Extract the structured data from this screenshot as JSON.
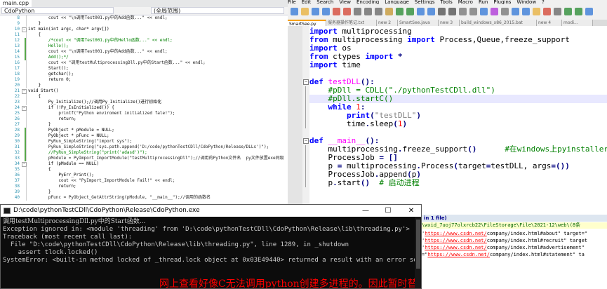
{
  "vs": {
    "tab_label": "main.cpp",
    "nav_left": "CdoPython",
    "nav_right": "(全局范围)",
    "lines": [
      {
        "n": "8",
        "t": "        cout << \"\\n调用Test001.py中的Add函数...\" << endl;"
      },
      {
        "n": "9",
        "t": "    }"
      },
      {
        "n": "10",
        "t": "int main(int argc, char* argv[])"
      },
      {
        "n": "11",
        "t": "    {"
      },
      {
        "n": "12",
        "t": "        /*cout << \"调用Test001.py中的Hello函数...\" << endl;"
      },
      {
        "n": "13",
        "t": "        Hello();"
      },
      {
        "n": "14",
        "t": "        cout << \"\\n调用Test001.py中的Add函数...\" << endl;"
      },
      {
        "n": "15",
        "t": "        Add();*/"
      },
      {
        "n": "16",
        "t": "        cout << \"调用testMultiprocessingDll.py中的Start函数...\" << endl;"
      },
      {
        "n": "17",
        "t": "        Start();"
      },
      {
        "n": "18",
        "t": "        getchar();"
      },
      {
        "n": "19",
        "t": "        return 0;"
      },
      {
        "n": "20",
        "t": "    }"
      },
      {
        "n": "21",
        "t": "void Start()"
      },
      {
        "n": "22",
        "t": "    {"
      },
      {
        "n": "23",
        "t": "        Py_Initialize();//调用Py_Initialize()进行初始化"
      },
      {
        "n": "24",
        "t": "        if (!Py_IsInitialized()) {"
      },
      {
        "n": "25",
        "t": "            printf(\"Python enviroment initialized fale!\");"
      },
      {
        "n": "26",
        "t": "            return;"
      },
      {
        "n": "27",
        "t": "        }"
      },
      {
        "n": "28",
        "t": "        PyObject * pModule = NULL;"
      },
      {
        "n": "29",
        "t": "        PyObject * pFunc = NULL;"
      },
      {
        "n": "30",
        "t": "        PyRun_SimpleString(\"import sys\");"
      },
      {
        "n": "31",
        "t": "        PyRun_SimpleString(\"sys.path.append('D:/code/pythonTestCDll/CdoPython/Release/DLLs')\");"
      },
      {
        "n": "32",
        "t": "        //PyRun_SimpleString(\"print('adasd')\");"
      },
      {
        "n": "33",
        "t": "        pModule = PyImport_ImportModule(\"testMultiprocessingDll\");//调用的Python文件名  py文件放置exe同级"
      },
      {
        "n": "34",
        "t": "        if (pModule == NULL)"
      },
      {
        "n": "35",
        "t": "        {"
      },
      {
        "n": "36",
        "t": "            PyErr_Print();"
      },
      {
        "n": "37",
        "t": "            cout << \"PyImport_ImportModule Fail!\" << endl;"
      },
      {
        "n": "38",
        "t": "            return;"
      },
      {
        "n": "39",
        "t": "        }"
      },
      {
        "n": "40",
        "t": "        pFunc = PyObject_GetAttrString(pModule, \"__main__\");//调用的函数名"
      }
    ]
  },
  "npp": {
    "menu": [
      "File",
      "Edit",
      "Search",
      "View",
      "Encoding",
      "Language",
      "Settings",
      "Tools",
      "Macro",
      "Run",
      "Plugins",
      "Window",
      "?"
    ],
    "tabs": [
      "SmartSee.py",
      "服务器操作笔记.txt",
      "new 2",
      "SmartSee.java",
      "new 3",
      "build_windows_x86_2015.bat",
      "new 4",
      "modi..."
    ],
    "active_tab": 0,
    "code": [
      {
        "parts": [
          {
            "c": "kw",
            "t": "import"
          },
          {
            "c": "",
            "t": " multiprocessing"
          }
        ]
      },
      {
        "parts": [
          {
            "c": "kw",
            "t": "from"
          },
          {
            "c": "",
            "t": " multiprocessing "
          },
          {
            "c": "kw",
            "t": "import"
          },
          {
            "c": "",
            "t": " Process,Queue,freeze_support"
          }
        ]
      },
      {
        "parts": [
          {
            "c": "kw",
            "t": "import"
          },
          {
            "c": "",
            "t": " os"
          }
        ]
      },
      {
        "parts": [
          {
            "c": "kw",
            "t": "from"
          },
          {
            "c": "",
            "t": " ctypes "
          },
          {
            "c": "kw",
            "t": "import"
          },
          {
            "c": "",
            "t": " "
          },
          {
            "c": "op",
            "t": "*"
          }
        ]
      },
      {
        "parts": [
          {
            "c": "kw",
            "t": "import"
          },
          {
            "c": "",
            "t": " time"
          }
        ]
      },
      {
        "parts": []
      },
      {
        "parts": [
          {
            "c": "kw",
            "t": "def"
          },
          {
            "c": "",
            "t": " "
          },
          {
            "c": "fn",
            "t": "testDLL"
          },
          {
            "c": "op",
            "t": "():"
          }
        ]
      },
      {
        "parts": [
          {
            "c": "",
            "t": "    "
          },
          {
            "c": "cm",
            "t": "#pDll = CDLL(\"./pythonTestCDll.dll\")"
          }
        ]
      },
      {
        "parts": [
          {
            "c": "",
            "t": "    "
          },
          {
            "c": "cm",
            "t": "#pDll.startC()"
          }
        ],
        "hl": true
      },
      {
        "parts": [
          {
            "c": "",
            "t": "    "
          },
          {
            "c": "kw",
            "t": "while"
          },
          {
            "c": "",
            "t": " "
          },
          {
            "c": "nm",
            "t": "1"
          },
          {
            "c": "op",
            "t": ":"
          }
        ]
      },
      {
        "parts": [
          {
            "c": "",
            "t": "        "
          },
          {
            "c": "kw",
            "t": "print"
          },
          {
            "c": "op",
            "t": "("
          },
          {
            "c": "st",
            "t": "\"testDLL\""
          },
          {
            "c": "op",
            "t": ")"
          }
        ]
      },
      {
        "parts": [
          {
            "c": "",
            "t": "        time"
          },
          {
            "c": "op",
            "t": "."
          },
          {
            "c": "",
            "t": "sleep"
          },
          {
            "c": "op",
            "t": "("
          },
          {
            "c": "nm",
            "t": "1"
          },
          {
            "c": "op",
            "t": ")"
          }
        ]
      },
      {
        "parts": []
      },
      {
        "parts": [
          {
            "c": "kw",
            "t": "def"
          },
          {
            "c": "",
            "t": " "
          },
          {
            "c": "fn",
            "t": "__main__"
          },
          {
            "c": "op",
            "t": "():"
          }
        ]
      },
      {
        "parts": [
          {
            "c": "",
            "t": "    multiprocessing"
          },
          {
            "c": "op",
            "t": "."
          },
          {
            "c": "",
            "t": "freeze_support"
          },
          {
            "c": "op",
            "t": "()"
          },
          {
            "c": "",
            "t": "      "
          },
          {
            "c": "cm",
            "t": "#在windows上pyinstaller打包"
          }
        ]
      },
      {
        "parts": [
          {
            "c": "",
            "t": "    ProcessJob "
          },
          {
            "c": "op",
            "t": "="
          },
          {
            "c": "",
            "t": " "
          },
          {
            "c": "op",
            "t": "[]"
          }
        ]
      },
      {
        "parts": [
          {
            "c": "",
            "t": "    p "
          },
          {
            "c": "op",
            "t": "="
          },
          {
            "c": "",
            "t": " multiprocessing"
          },
          {
            "c": "op",
            "t": "."
          },
          {
            "c": "",
            "t": "Process"
          },
          {
            "c": "op",
            "t": "("
          },
          {
            "c": "",
            "t": "target"
          },
          {
            "c": "op",
            "t": "="
          },
          {
            "c": "",
            "t": "testDLL, args"
          },
          {
            "c": "op",
            "t": "=())"
          }
        ]
      },
      {
        "parts": [
          {
            "c": "",
            "t": "    ProcessJob"
          },
          {
            "c": "op",
            "t": "."
          },
          {
            "c": "",
            "t": "append"
          },
          {
            "c": "op",
            "t": "("
          },
          {
            "c": "",
            "t": "p"
          },
          {
            "c": "op",
            "t": ")"
          }
        ]
      },
      {
        "parts": [
          {
            "c": "",
            "t": "    p"
          },
          {
            "c": "op",
            "t": "."
          },
          {
            "c": "",
            "t": "start"
          },
          {
            "c": "op",
            "t": "()"
          },
          {
            "c": "",
            "t": "  "
          },
          {
            "c": "cm",
            "t": "# 启动进程"
          }
        ]
      }
    ]
  },
  "results": {
    "header": "in 1 file)",
    "path": "\\wxid_7uoj77olxrcb22\\FileStorage\\File\\2021-12\\web\\(8条",
    "lines": [
      {
        "pre": "'",
        "url": "https://www.csdn.net/",
        "post": "company/index.html#about\" target=\""
      },
      {
        "pre": "'",
        "url": "https://www.csdn.net/",
        "post": "company/index.html#recruit\" target"
      },
      {
        "pre": "'",
        "url": "https://www.csdn.net/",
        "post": "company/index.html#advertisement\" "
      },
      {
        "pre": "=\"",
        "url": "https://www.csdn.net/",
        "post": "company/index.html#statement\" ta"
      }
    ]
  },
  "cmd": {
    "title": "D:\\code\\pythonTestCDll\\CdoPython\\Release\\CdoPython.exe",
    "minimize": "—",
    "maximize": "☐",
    "close": "✕",
    "lines": [
      "调用testMultiprocessingDll.py中的Start函数...",
      "Exception ignored in: <module 'threading' from 'D:\\code\\pythonTestCDll\\CdoPython\\Release\\lib\\threading.py'>",
      "Traceback (most recent call last):",
      "  File \"D:\\code\\pythonTestCDll\\CdoPython\\Release\\lib\\threading.py\", line 1289, in _shutdown",
      "    assert tlock.locked()",
      "SystemError: <built-in method locked of _thread.lock object at 0x03E49440> returned a result with an error set"
    ],
    "annotation": "网上查看好像C无法调用python创建多进程的。因此暂时替换方法"
  },
  "colors": {
    "keyword": "#0000ff",
    "function": "#ff00ff",
    "comment": "#008000",
    "string": "#808080",
    "number": "#ff0000",
    "annotation": "#ff0000"
  }
}
